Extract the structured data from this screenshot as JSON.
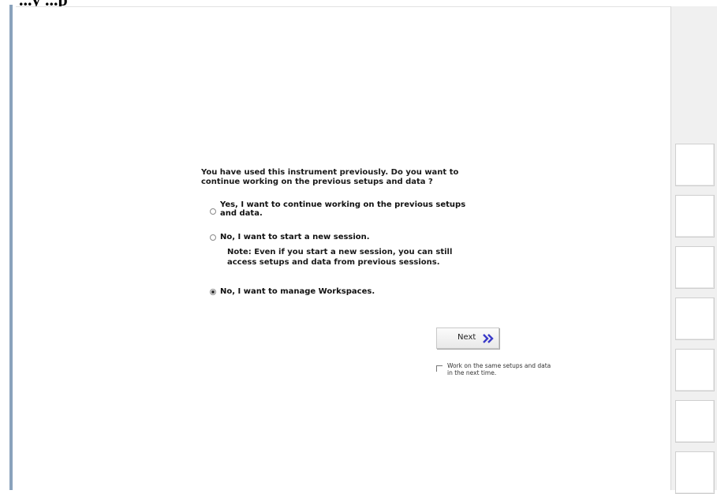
{
  "header": {
    "partial_title": "...y     ...p"
  },
  "prompt": {
    "line1": "You have used this instrument previously. Do you want to",
    "line2": "continue working on the previous setups and data ?"
  },
  "options": {
    "continue": {
      "line1": "Yes, I want to continue working on the previous setups",
      "line2": "and data.",
      "selected": false
    },
    "new_session": {
      "label": "No, I want to start a new session.",
      "selected": false
    },
    "manage_workspaces": {
      "label": "No, I want to manage Workspaces.",
      "selected": true
    }
  },
  "note": {
    "line1": "Note: Even if you start a new session, you can still",
    "line2": "access setups and data from previous sessions."
  },
  "next_button": {
    "label": "Next",
    "icon": "double-chevron-right-icon",
    "accent_color": "#3a3ac8"
  },
  "remember_checkbox": {
    "checked": false,
    "line1": "Work on the same setups and data",
    "line2": "in the next time."
  },
  "softkeys": {
    "count": 7
  }
}
